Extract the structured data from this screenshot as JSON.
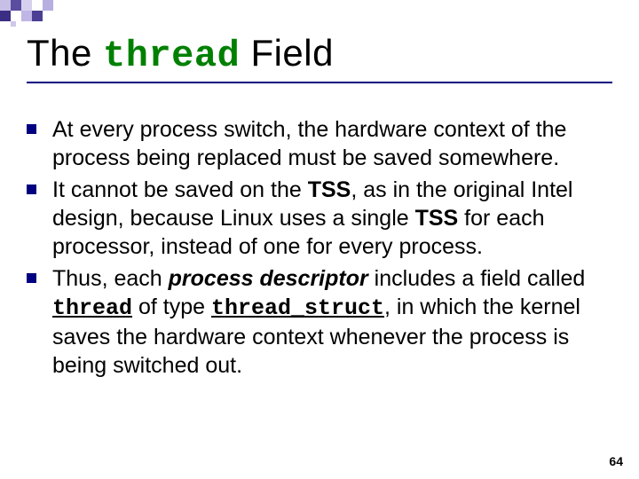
{
  "title": {
    "pre": "The ",
    "code": "thread",
    "post": " Field"
  },
  "bullets": [
    {
      "t1": "At every process switch, the hardware context of the process being replaced must be saved somewhere."
    },
    {
      "t1": "It cannot be saved on the ",
      "b1": "TSS",
      "t2": ", as in the original Intel design, because Linux uses a single ",
      "b2": "TSS",
      "t3": " for each processor, instead of one for every process."
    },
    {
      "t1": "Thus, each ",
      "e1": "process descriptor",
      "t2": " includes a field called ",
      "c1": "thread",
      "t3": " of type ",
      "c2": "thread_struct",
      "t4": ", in which the kernel saves the hardware context whenever the process is being switched out."
    }
  ],
  "page": "64"
}
